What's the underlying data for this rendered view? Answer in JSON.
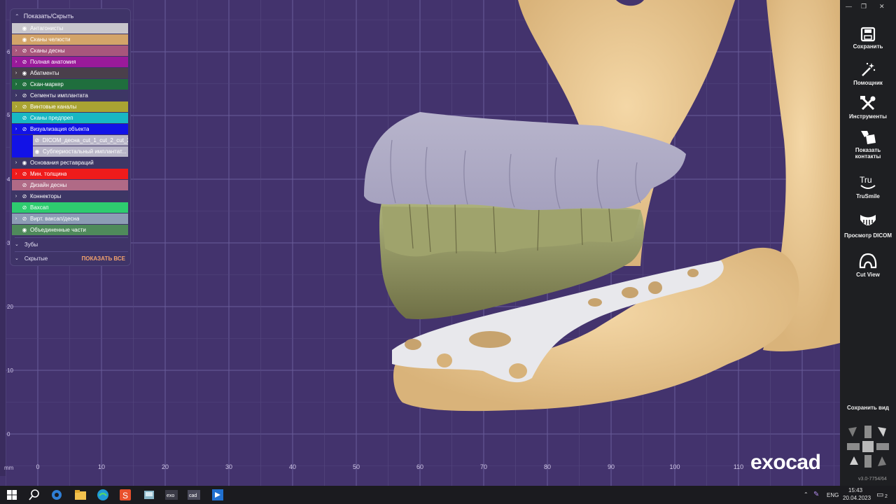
{
  "panel": {
    "title": "Показать/Скрыть",
    "layers": [
      {
        "label": "Антагонисты",
        "color": "#c8c6cc",
        "expand": false,
        "visible": true
      },
      {
        "label": "Сканы челюсти",
        "color": "#d3a469",
        "expand": false,
        "visible": true
      },
      {
        "label": "Сканы десны",
        "color": "#a8567c",
        "expand": true,
        "visible": false
      },
      {
        "label": "Полная анатомия",
        "color": "#9a1a9a",
        "expand": true,
        "visible": false
      },
      {
        "label": "Абатменты",
        "color": "#4a3f4b",
        "expand": true,
        "visible": true
      },
      {
        "label": "Скан-маркер",
        "color": "#1f6e3d",
        "expand": true,
        "visible": false
      },
      {
        "label": "Сегменты имплантата",
        "color": "#3d3665",
        "expand": true,
        "visible": false
      },
      {
        "label": "Винтовые каналы",
        "color": "#a9a332",
        "expand": true,
        "visible": false
      },
      {
        "label": "Сканы предпреп",
        "color": "#18b7c3",
        "expand": false,
        "visible": false
      },
      {
        "label": "Визуализация объекта",
        "color": "#1212e6",
        "expand": true,
        "visible": false
      },
      {
        "label": "DICOM_десна_cut_1_cut_2_cut_2",
        "color": "#b9b6c8",
        "sub": true,
        "visible": false
      },
      {
        "label": "Субпериостальный имплантат...",
        "color": "#b9b6c8",
        "sub": true,
        "visible": true
      },
      {
        "label": "Основания реставраций",
        "color": "#3d3665",
        "expand": true,
        "visible": true
      },
      {
        "label": "Мин. толщина",
        "color": "#ef1b1b",
        "expand": true,
        "visible": false
      },
      {
        "label": "Дизайн десны",
        "color": "#b06a86",
        "expand": false,
        "visible": false
      },
      {
        "label": "Коннекторы",
        "color": "#3d3665",
        "expand": true,
        "visible": false
      },
      {
        "label": "Вахcап",
        "color": "#2ecc6f",
        "expand": false,
        "visible": false
      },
      {
        "label": "Вирт. вакcап/десна",
        "color": "#8c9cb4",
        "expand": true,
        "visible": false
      },
      {
        "label": "Объединенные части",
        "color": "#4f8a5b",
        "expand": false,
        "visible": true
      }
    ],
    "section_teeth": "Зубы",
    "section_hidden": "Скрытые",
    "show_all": "ПОКАЗАТЬ ВСЕ"
  },
  "viewport": {
    "unit": "mm",
    "x_ticks": [
      "0",
      "10",
      "20",
      "30",
      "40",
      "50",
      "60",
      "70",
      "80",
      "90",
      "100",
      "110"
    ],
    "y_ticks": [
      "6",
      "5",
      "4",
      "3",
      "20",
      "10",
      "0"
    ],
    "brand": "exocad"
  },
  "toolbar": {
    "tools": [
      {
        "label": "Сохранить",
        "icon": "save-icon"
      },
      {
        "label": "Помощник",
        "icon": "magic-wand-icon"
      },
      {
        "label": "Инструменты",
        "icon": "tools-icon"
      },
      {
        "label": "Показать контакты",
        "icon": "contacts-icon"
      },
      {
        "label": "TruSmile",
        "icon": "trusmile-icon"
      },
      {
        "label": "Просмотр DICOM",
        "icon": "dicom-icon"
      },
      {
        "label": "Cut View",
        "icon": "cut-view-icon"
      }
    ],
    "save_view": "Сохранить вид",
    "version": "v3.0-7754/64"
  },
  "taskbar": {
    "lang": "ENG",
    "time": "15:43",
    "date": "20.04.2023",
    "notifications": "2"
  }
}
